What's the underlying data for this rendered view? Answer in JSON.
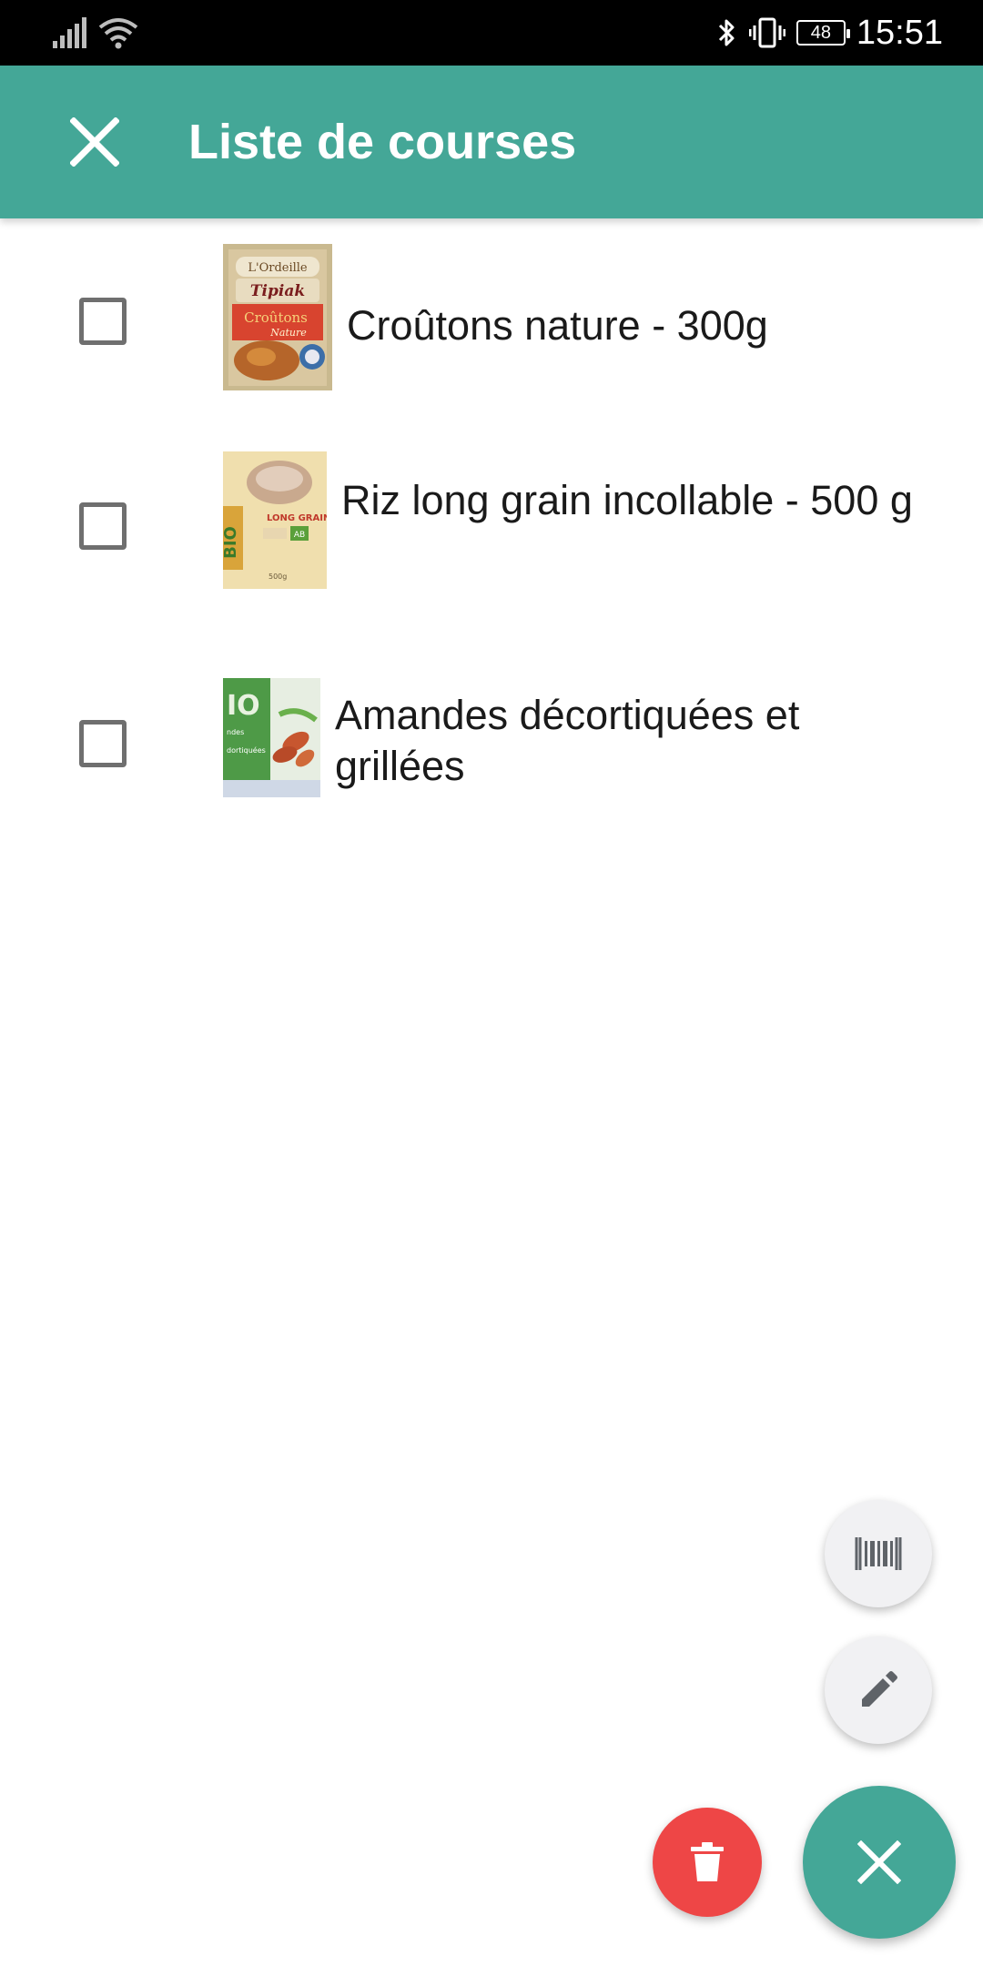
{
  "status_bar": {
    "time": "15:51",
    "battery_level": "48",
    "icons": [
      "signal-icon",
      "wifi-icon",
      "bluetooth-icon",
      "vibrate-icon",
      "battery-icon"
    ]
  },
  "app_bar": {
    "title": "Liste de courses",
    "close_icon": "close-icon",
    "background_color": "#44a797"
  },
  "items": [
    {
      "label": "Croûtons nature - 300g",
      "checked": false,
      "thumbnail": "croutons-product-image"
    },
    {
      "label": "Riz long grain incollable - 500 g",
      "checked": false,
      "thumbnail": "rice-product-image"
    },
    {
      "label": "Amandes décortiquées et grillées",
      "checked": false,
      "thumbnail": "almonds-product-image"
    }
  ],
  "fabs": {
    "scan_icon": "barcode-icon",
    "edit_icon": "pencil-icon",
    "delete_icon": "trash-icon",
    "main_icon": "close-icon",
    "delete_color": "#ee4646",
    "main_color": "#44a797"
  }
}
